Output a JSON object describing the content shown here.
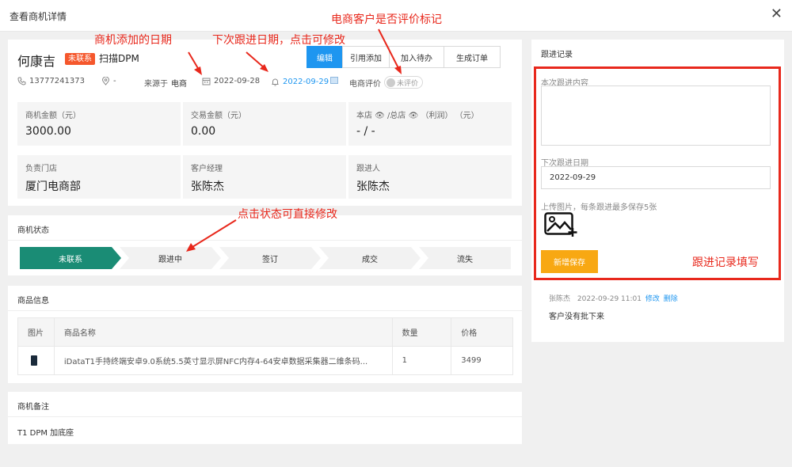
{
  "window": {
    "title": "查看商机详情",
    "close": "✕"
  },
  "header": {
    "name": "何康吉",
    "badge": "未联系",
    "tag": "扫描DPM",
    "buttons": [
      "编辑",
      "引用添加",
      "加入待办",
      "生成订单"
    ]
  },
  "info": {
    "phone": "13777241373",
    "location": "-",
    "source_label": "来源于",
    "source_value": "电商",
    "added_date": "2022-09-28",
    "next_date": "2022-09-29",
    "eval_label": "电商评价",
    "eval_state": "未评价"
  },
  "stats": [
    {
      "label": "商机金额（元）",
      "value": "3000.00"
    },
    {
      "label": "交易金额（元）",
      "value": "0.00"
    },
    {
      "label": "本店 👁 /总店 👁 （利润） （元）",
      "value": "- / -"
    },
    {
      "label": "负责门店",
      "value": "厦门电商部"
    },
    {
      "label": "客户经理",
      "value": "张陈杰"
    },
    {
      "label": "跟进人",
      "value": "张陈杰"
    }
  ],
  "status": {
    "title": "商机状态",
    "steps": [
      "未联系",
      "跟进中",
      "签订",
      "成交",
      "流失"
    ],
    "active_index": 0
  },
  "goods": {
    "title": "商品信息",
    "columns": [
      "图片",
      "商品名称",
      "数量",
      "价格"
    ],
    "rows": [
      {
        "name": "iDataT1手持终端安卓9.0系统5.5英寸显示屏NFC内存4-64安卓数据采集器二维条码...",
        "qty": "1",
        "price": "3499"
      }
    ]
  },
  "remark": {
    "title": "商机备注",
    "text": "T1  DPM 加底座"
  },
  "followup": {
    "title": "跟进记录",
    "content_label": "本次跟进内容",
    "next_label": "下次跟进日期",
    "next_value": "2022-09-29",
    "upload_label": "上传图片，每条跟进最多保存5张",
    "save_label": "新增保存",
    "fill_note": "跟进记录填写"
  },
  "log": {
    "user": "张陈杰",
    "time": "2022-09-29 11:01",
    "edit": "修改",
    "delete": "删除",
    "text": "客户没有批下来"
  },
  "annotations": {
    "added_date": "商机添加的日期",
    "next_date": "下次跟进日期，点击可修改",
    "eval_mark": "电商客户是否评价标记",
    "status_edit": "点击状态可直接修改"
  },
  "colors": {
    "primary": "#1e96f0",
    "active_step": "#1a8c75",
    "badge": "#f5572c",
    "save": "#f8a813",
    "annotation": "#e8281c"
  }
}
